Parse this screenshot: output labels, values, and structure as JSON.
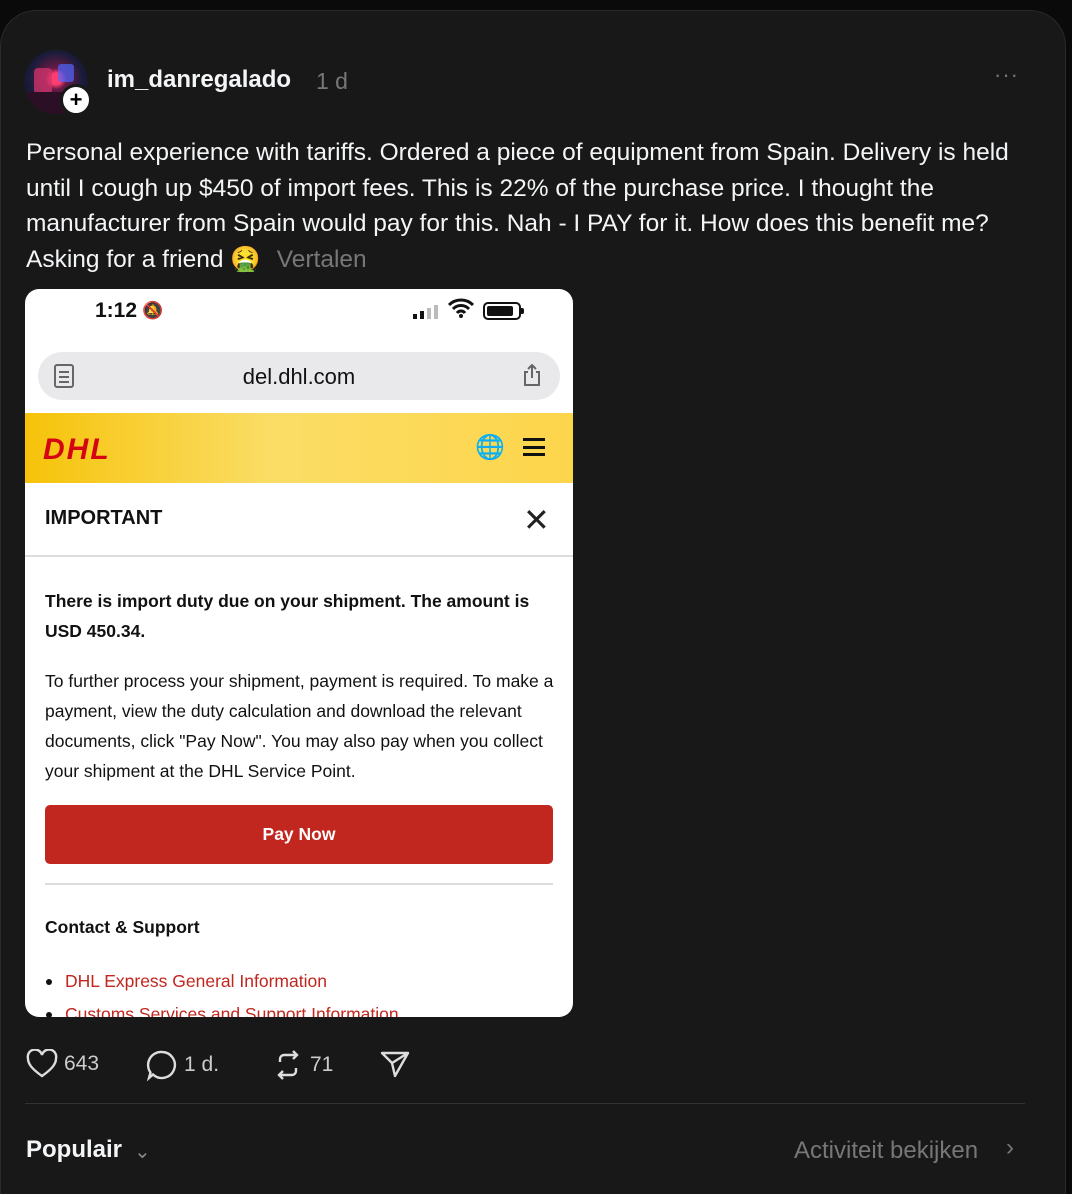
{
  "post": {
    "username": "im_danregalado",
    "time": "1 d",
    "more": "···",
    "follow": "+",
    "text": "Personal experience with tariffs. Ordered a piece of equipment from Spain. Delivery is held until I cough up $450 of import fees. This is 22% of the purchase price. I thought the manufacturer from Spain would pay for this. Nah - I PAY for it. How does this benefit me? Asking for a friend 🤮",
    "translate": "Vertalen"
  },
  "screenshot": {
    "status_time": "1:12",
    "url": "del.dhl.com",
    "logo": "DHL",
    "modal_title": "IMPORTANT",
    "duty_text": "There is import duty due on your shipment. The amount is USD 450.34.",
    "body_text": "To further process your shipment, payment is required. To make a payment, view the duty calculation and download the relevant documents, click \"Pay Now\". You may also pay when you collect your shipment at the DHL Service Point.",
    "pay_button": "Pay Now",
    "contact_title": "Contact & Support",
    "links": [
      "DHL Express General Information",
      "Customs Services and Support Information"
    ],
    "brand_color": "#d40511",
    "button_color": "#c1261f",
    "header_color": "#f6c30a"
  },
  "actions": {
    "likes": "643",
    "comments": "1 d.",
    "reposts": "71"
  },
  "footer": {
    "sort": "Populair",
    "activity": "Activiteit bekijken"
  },
  "icons": [
    "heart-icon",
    "comment-icon",
    "repost-icon",
    "share-icon",
    "chevron-down-icon",
    "chevron-right-icon",
    "globe-icon",
    "menu-icon",
    "close-icon",
    "wifi-icon",
    "battery-icon",
    "bell-slash-icon"
  ]
}
